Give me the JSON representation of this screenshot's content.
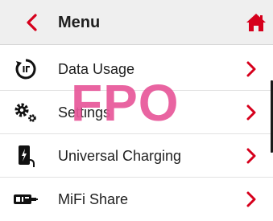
{
  "header": {
    "title": "Menu",
    "back_icon": "chevron-left-icon",
    "home_icon": "home-icon"
  },
  "menu": {
    "items": [
      {
        "label": "Data Usage",
        "icon": "data-usage-gauge-icon"
      },
      {
        "label": "Settings",
        "icon": "gears-icon"
      },
      {
        "label": "Universal Charging",
        "icon": "charging-phone-icon"
      },
      {
        "label": "MiFi Share",
        "icon": "mifi-device-icon"
      }
    ]
  },
  "watermark": {
    "text": "FPO"
  },
  "colors": {
    "accent": "#d6001c",
    "header_bg": "#efefef",
    "text": "#1f1f1f",
    "watermark": "#e8579a"
  }
}
